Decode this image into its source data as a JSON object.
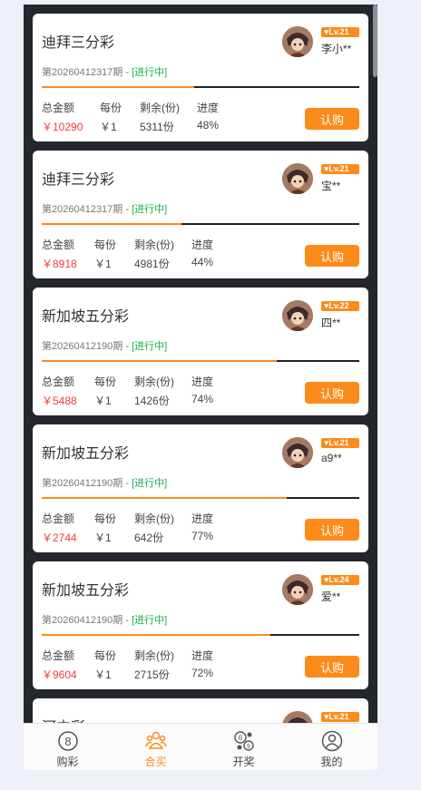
{
  "colors": {
    "accent": "#fd8b1a",
    "money": "#f23c3c",
    "status": "#16b14a",
    "background": "#24272c"
  },
  "labels": {
    "total": "总金额",
    "per_share": "每份",
    "remaining": "剩余(份)",
    "progress": "进度",
    "buy": "认购"
  },
  "cards": [
    {
      "title": "迪拜三分彩",
      "period": "第20260412317期 - ",
      "status": "[进行中]",
      "level": "Lv.21",
      "user": "李小**",
      "total": "￥10290",
      "per": "￥1",
      "remaining": "5311份",
      "progress": "48%",
      "progress_value": 48
    },
    {
      "title": "迪拜三分彩",
      "period": "第20260412317期 - ",
      "status": "[进行中]",
      "level": "Lv.21",
      "user": "宝**",
      "total": "￥8918",
      "per": "￥1",
      "remaining": "4981份",
      "progress": "44%",
      "progress_value": 44
    },
    {
      "title": "新加坡五分彩",
      "period": "第20260412190期 - ",
      "status": "[进行中]",
      "level": "Lv.22",
      "user": "四**",
      "total": "￥5488",
      "per": "￥1",
      "remaining": "1426份",
      "progress": "74%",
      "progress_value": 74
    },
    {
      "title": "新加坡五分彩",
      "period": "第20260412190期 - ",
      "status": "[进行中]",
      "level": "Lv.21",
      "user": "a9**",
      "total": "￥2744",
      "per": "￥1",
      "remaining": "642份",
      "progress": "77%",
      "progress_value": 77
    },
    {
      "title": "新加坡五分彩",
      "period": "第20260412190期 - ",
      "status": "[进行中]",
      "level": "Lv.24",
      "user": "爱**",
      "total": "￥9604",
      "per": "￥1",
      "remaining": "2715份",
      "progress": "72%",
      "progress_value": 72
    },
    {
      "title": "河内彩",
      "level": "Lv.21"
    }
  ],
  "tabs": [
    {
      "label": "购彩",
      "icon": "lottery-ball-icon",
      "active": false
    },
    {
      "label": "合买",
      "icon": "group-buy-icon",
      "active": true
    },
    {
      "label": "开奖",
      "icon": "draw-results-icon",
      "active": false
    },
    {
      "label": "我的",
      "icon": "profile-icon",
      "active": false
    }
  ]
}
